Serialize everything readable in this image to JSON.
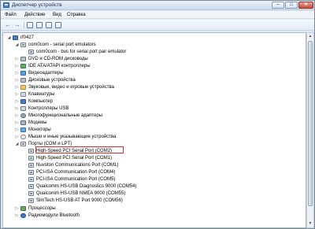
{
  "window": {
    "title": "Диспетчер устройств",
    "buttons": {
      "minimize": "–",
      "maximize": "□",
      "close": "✕"
    }
  },
  "menu": {
    "items": [
      "Файл",
      "Действие",
      "Вид",
      "Справка"
    ]
  },
  "toolbar": {
    "back": "←",
    "forward": "→"
  },
  "tree": {
    "root": "rf0427",
    "items": [
      {
        "label": "com0com - serial port emulators",
        "expanded": "◢"
      },
      {
        "label": "com0com - bus for serial port pair emulator"
      },
      {
        "label": "DVD и CD-ROM дисководы",
        "expanded": "▷"
      },
      {
        "label": "IDE ATA/ATAPI контроллеры",
        "expanded": "▷"
      },
      {
        "label": "Видеоадаптеры",
        "expanded": "▷"
      },
      {
        "label": "Дисковые устройства",
        "expanded": "▷"
      },
      {
        "label": "Звуковые, видео и игровые устройства",
        "expanded": "▷"
      },
      {
        "label": "Клавиатуры",
        "expanded": "▷"
      },
      {
        "label": "Компьютер",
        "expanded": "▷"
      },
      {
        "label": "Контроллеры USB",
        "expanded": "▷"
      },
      {
        "label": "Многофункциональные адаптеры",
        "expanded": "▷"
      },
      {
        "label": "Модемы",
        "expanded": "▷"
      },
      {
        "label": "Мониторы",
        "expanded": "▷"
      },
      {
        "label": "Мыши и иные указывающие устройства",
        "expanded": "▷"
      },
      {
        "label": "Порты (COM и LPT)",
        "expanded": "◢"
      },
      {
        "label": "High-Speed PCI Serial Port (COM2)"
      },
      {
        "label": "High-Speed PCI Serial Port (COM1)"
      },
      {
        "label": "Nuvoton Communications Port (COM1)"
      },
      {
        "label": "PCI-ISA Communication Port (COM4)"
      },
      {
        "label": "PCI-ISA Communication Port (COM5)"
      },
      {
        "label": "Qualcomm HS-USB Diagnostics 9000 (COM54)"
      },
      {
        "label": "Qualcomm HS-USB NMEA 9000 (COM55)"
      },
      {
        "label": "SimTech HS-USB AT Port 9000 (COM56)"
      },
      {
        "label": "Процессоры",
        "expanded": "▷"
      },
      {
        "label": "Радиомодули Bluetooth",
        "expanded": "▷"
      }
    ]
  },
  "scrollbar": {
    "up": "▲",
    "down": "▼"
  }
}
